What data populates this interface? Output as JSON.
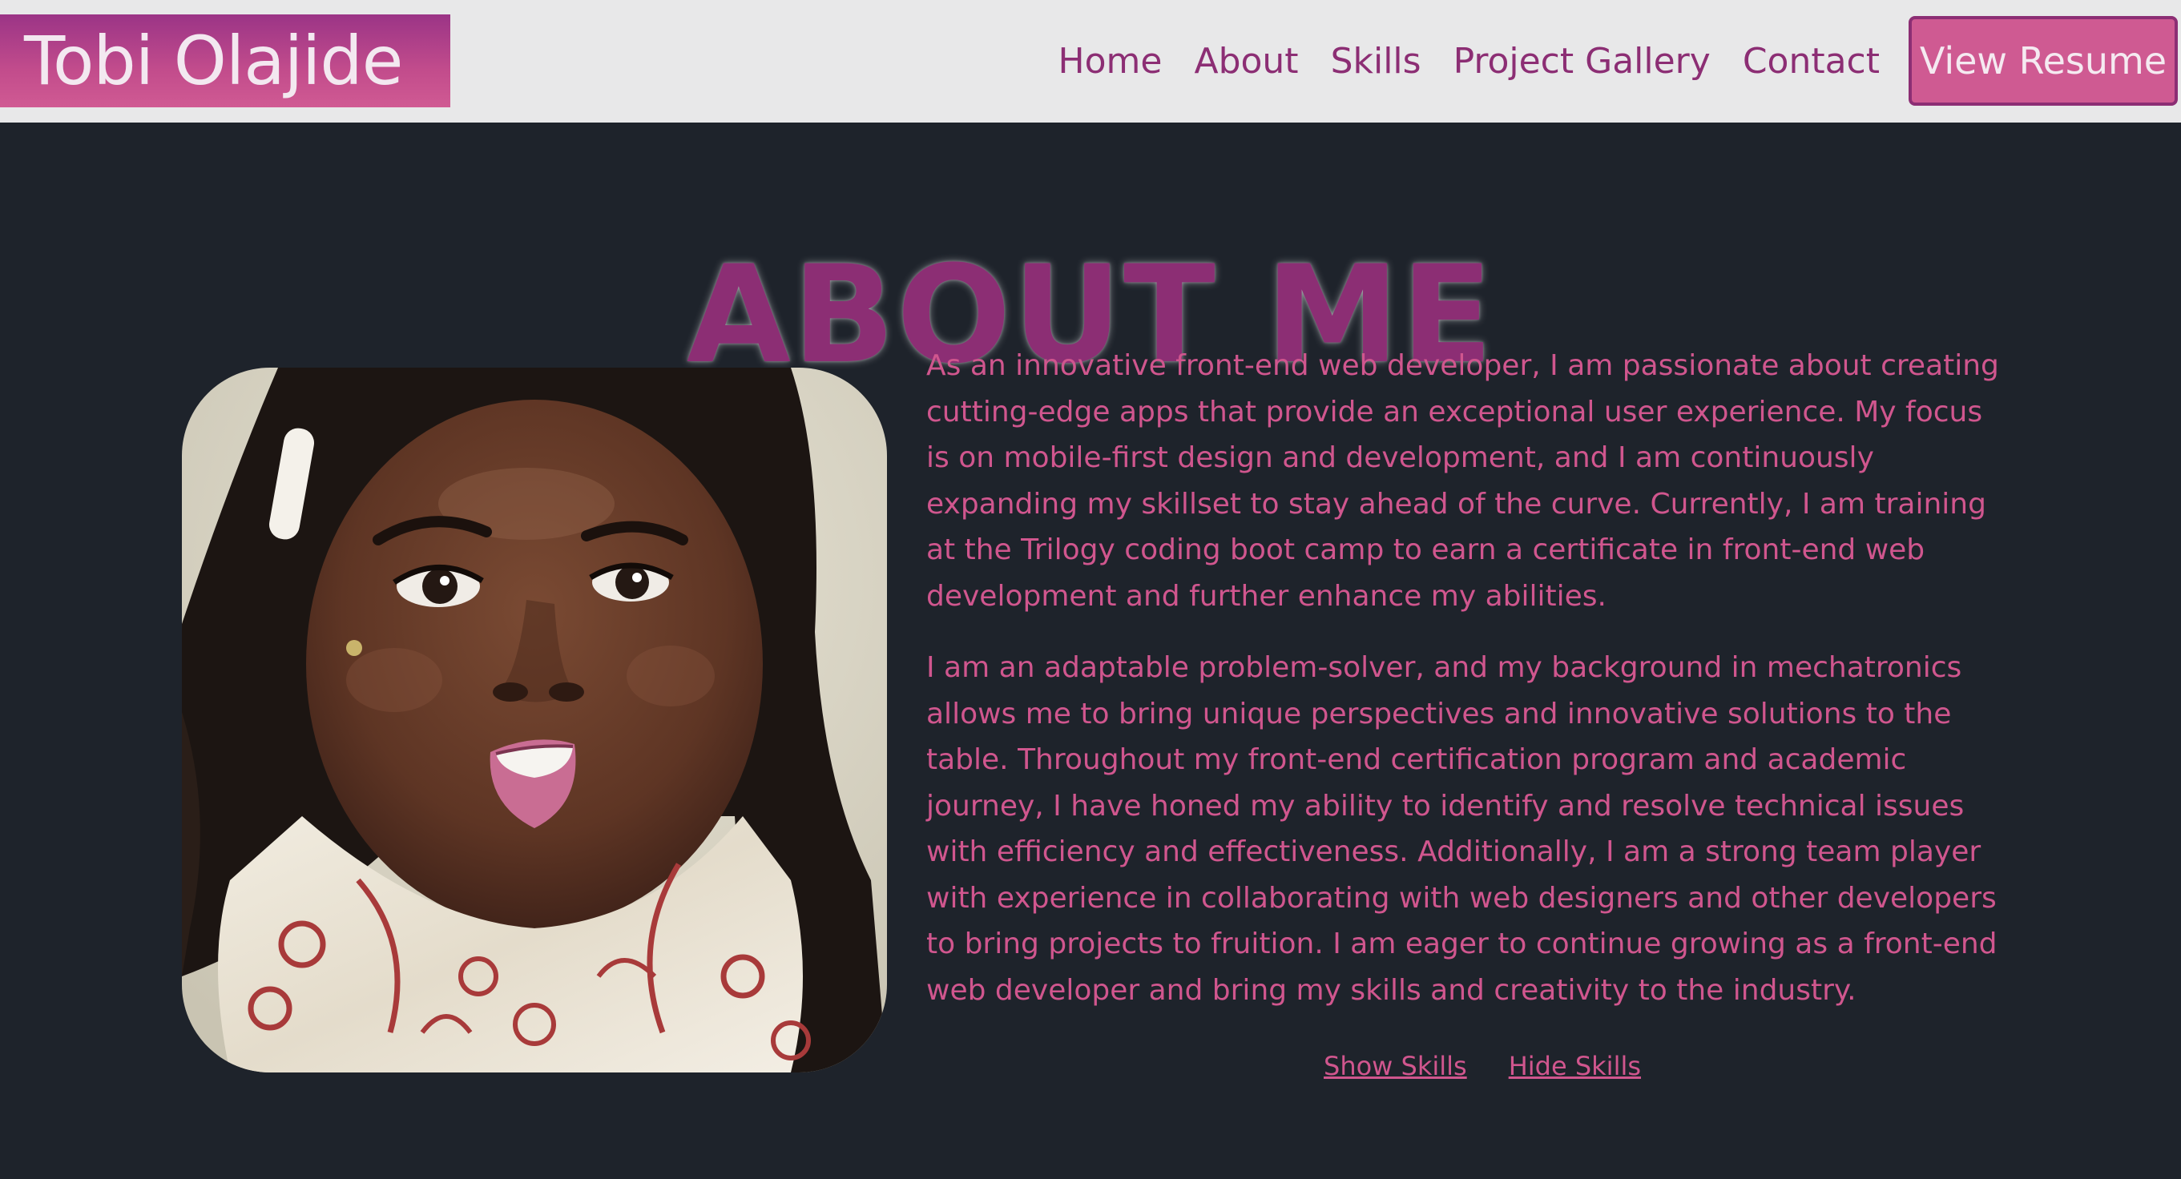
{
  "header": {
    "brand": "Tobi Olajide",
    "nav": [
      "Home",
      "About",
      "Skills",
      "Project Gallery",
      "Contact"
    ],
    "resume_button": "View Resume"
  },
  "about": {
    "title": "ABOUT ME",
    "photo_alt": "Portrait photo",
    "paragraphs": [
      "As an innovative front-end web developer, I am passionate about creating cutting-edge apps that provide an exceptional user experience. My focus is on mobile-first design and development, and I am continuously expanding my skillset to stay ahead of the curve. Currently, I am training at the Trilogy coding boot camp to earn a certificate in front-end web development and further enhance my abilities.",
      "I am an adaptable problem-solver, and my background in mechatronics allows me to bring unique perspectives and innovative solutions to the table. Throughout my front-end certification program and academic journey, I have honed my ability to identify and resolve technical issues with efficiency and effectiveness. Additionally, I am a strong team player with experience in collaborating with web designers and other developers to bring projects to fruition. I am eager to continue growing as a front-end web developer and bring my skills and creativity to the industry."
    ],
    "show_skills": "Show Skills",
    "hide_skills": "Hide Skills"
  },
  "colors": {
    "accent": "#8c2e74",
    "text_pink": "#d0568e",
    "background": "#1e232b",
    "navbar": "#e8e8e9"
  }
}
